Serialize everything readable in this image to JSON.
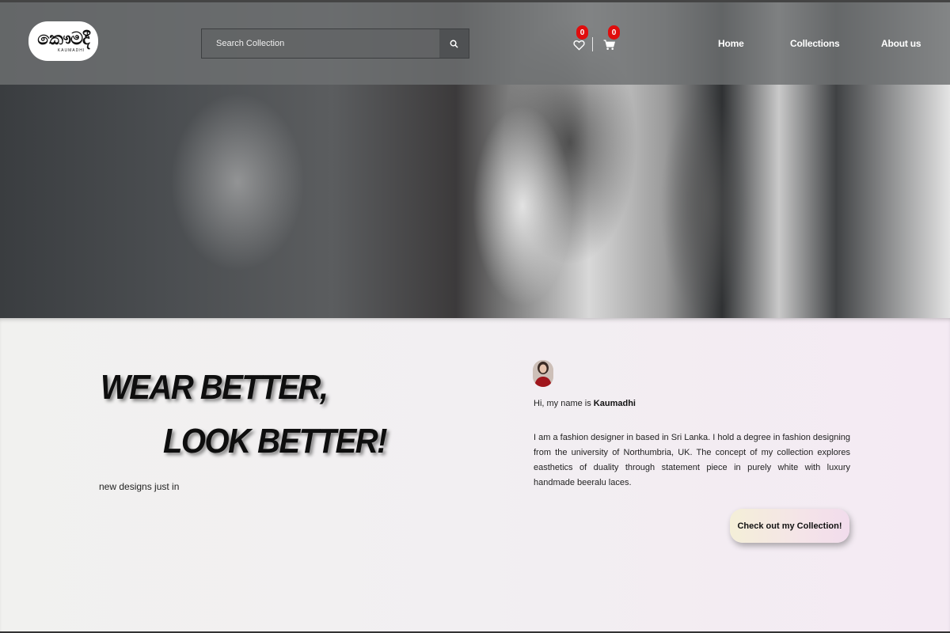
{
  "brand": {
    "logo_text": "කෞමදී",
    "logo_subtext": "KAUMADHI"
  },
  "search": {
    "placeholder": "Search Collection",
    "icon": "search-icon"
  },
  "header_icons": {
    "wishlist": {
      "icon": "heart-icon",
      "count": "0"
    },
    "cart": {
      "icon": "cart-icon",
      "count": "0"
    }
  },
  "nav": {
    "items": [
      {
        "label": "Home"
      },
      {
        "label": "Collections"
      },
      {
        "label": "About us"
      }
    ]
  },
  "hero": {
    "headline_line1": "WEAR BETTER,",
    "headline_line2": "LOOK BETTER!",
    "subtext": "new designs just in"
  },
  "about": {
    "intro_prefix": "Hi, my name is ",
    "name": "Kaumadhi",
    "bio": "I am a fashion designer in based in Sri Lanka. I hold a degree in fashion designing from the university of Northumbria, UK. The concept of my collection explores easthetics of duality through statement piece in purely white with luxury handmade beeralu laces.",
    "cta_label": "Check out my Collection!"
  },
  "colors": {
    "badge": "#e00d0d",
    "navbar": "#6e7072",
    "cta_gradient_start": "#f4efd8",
    "cta_gradient_end": "#f2dcec"
  }
}
